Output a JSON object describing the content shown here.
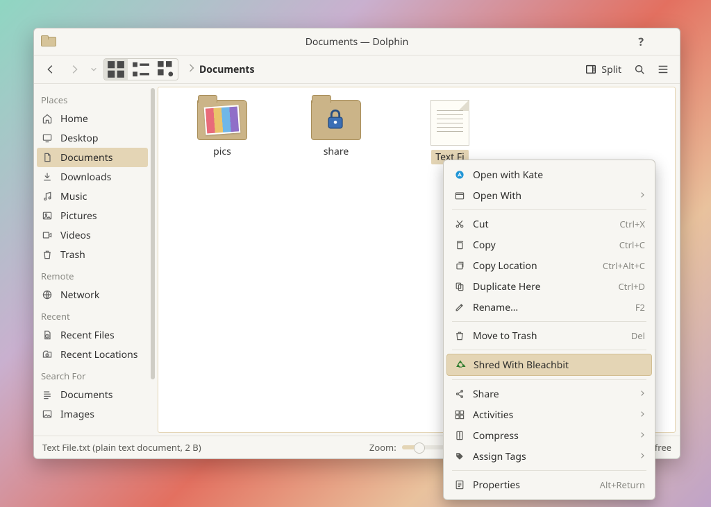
{
  "titlebar": {
    "title": "Documents — Dolphin"
  },
  "toolbar": {
    "breadcrumb": [
      "Documents"
    ],
    "split_label": "Split"
  },
  "sidebar": {
    "sections": [
      {
        "label": "Places",
        "items": [
          {
            "label": "Home",
            "icon": "home"
          },
          {
            "label": "Desktop",
            "icon": "desktop"
          },
          {
            "label": "Documents",
            "icon": "documents",
            "active": true
          },
          {
            "label": "Downloads",
            "icon": "downloads"
          },
          {
            "label": "Music",
            "icon": "music"
          },
          {
            "label": "Pictures",
            "icon": "pictures"
          },
          {
            "label": "Videos",
            "icon": "videos"
          },
          {
            "label": "Trash",
            "icon": "trash"
          }
        ]
      },
      {
        "label": "Remote",
        "items": [
          {
            "label": "Network",
            "icon": "network"
          }
        ]
      },
      {
        "label": "Recent",
        "items": [
          {
            "label": "Recent Files",
            "icon": "recent-files"
          },
          {
            "label": "Recent Locations",
            "icon": "recent-locations"
          }
        ]
      },
      {
        "label": "Search For",
        "items": [
          {
            "label": "Documents",
            "icon": "search-docs"
          },
          {
            "label": "Images",
            "icon": "search-images"
          }
        ]
      }
    ]
  },
  "files": [
    {
      "label": "pics",
      "thumb": "folder-pics"
    },
    {
      "label": "share",
      "thumb": "folder-share"
    },
    {
      "label": "Text File.txt",
      "thumb": "textfile",
      "selected": true,
      "display": "Text Fi"
    }
  ],
  "statusbar": {
    "selection": "Text File.txt (plain text document, 2 B)",
    "zoom_label": "Zoom:",
    "free_space": "B free"
  },
  "context_menu": [
    {
      "label": "Open with Kate",
      "icon": "kate"
    },
    {
      "label": "Open With",
      "icon": "open-with",
      "submenu": true
    },
    {
      "sep": true
    },
    {
      "label": "Cut",
      "icon": "cut",
      "shortcut": "Ctrl+X"
    },
    {
      "label": "Copy",
      "icon": "copy",
      "shortcut": "Ctrl+C"
    },
    {
      "label": "Copy Location",
      "icon": "copy-location",
      "shortcut": "Ctrl+Alt+C"
    },
    {
      "label": "Duplicate Here",
      "icon": "duplicate",
      "shortcut": "Ctrl+D"
    },
    {
      "label": "Rename…",
      "icon": "rename",
      "shortcut": "F2"
    },
    {
      "sep": true
    },
    {
      "label": "Move to Trash",
      "icon": "trash",
      "shortcut": "Del"
    },
    {
      "sep": true
    },
    {
      "label": "Shred With Bleachbit",
      "icon": "recycle",
      "highlight": true
    },
    {
      "sep": true
    },
    {
      "label": "Share",
      "icon": "share",
      "submenu": true
    },
    {
      "label": "Activities",
      "icon": "activities",
      "submenu": true
    },
    {
      "label": "Compress",
      "icon": "compress",
      "submenu": true
    },
    {
      "label": "Assign Tags",
      "icon": "tag",
      "submenu": true
    },
    {
      "sep": true
    },
    {
      "label": "Properties",
      "icon": "properties",
      "shortcut": "Alt+Return"
    }
  ]
}
